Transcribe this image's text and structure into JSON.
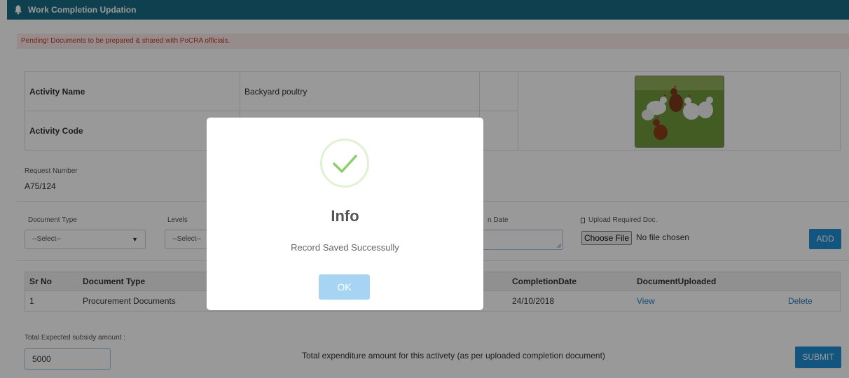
{
  "window": {
    "title": "Work Completion Updation"
  },
  "alert": {
    "pending_text": "Pending! Documents to be prepared & shared with PoCRA officials."
  },
  "activity": {
    "name_label": "Activity Name",
    "name_value": "Backyard poultry",
    "code_label": "Activity Code"
  },
  "request": {
    "label": "Request Number",
    "value": "A75/124"
  },
  "form": {
    "document_type_label": "Document Type",
    "document_type_selected": "--Select--",
    "levels_label": "Levels",
    "levels_selected": "--Select--",
    "completion_date_label_fragment": "n Date",
    "upload_label": "Upload Required Doc.",
    "choose_file_label": "Choose File",
    "no_file_text": "No file chosen",
    "add_label": "ADD"
  },
  "table": {
    "headers": {
      "sr_no": "Sr No",
      "document_type": "Document Type",
      "completion_date": "CompletionDate",
      "document_uploaded": "DocumentUploaded"
    },
    "rows": [
      {
        "sr_no": "1",
        "document_type": "Procurement Documents",
        "completion_date": "24/10/2018",
        "view": "View",
        "delete": "Delete"
      }
    ]
  },
  "footer": {
    "subsidy_label": "Total Expected subsidy amount :",
    "subsidy_value": "5000",
    "expenditure_label": "Total expenditure amount for this activety (as per uploaded completion document)",
    "submit_label": "SUBMIT"
  },
  "modal": {
    "title": "Info",
    "message": "Record Saved Successully",
    "ok_label": "OK"
  },
  "colors": {
    "titlebar": "#1a6c86",
    "button_primary": "#1f8ed3",
    "ok_button": "#a6d4f2",
    "check": "#8ccf6b"
  },
  "icons": {
    "titlebar_icon": "bell-icon",
    "success_icon": "checkmark-icon",
    "upload_icon": "upload-icon"
  }
}
